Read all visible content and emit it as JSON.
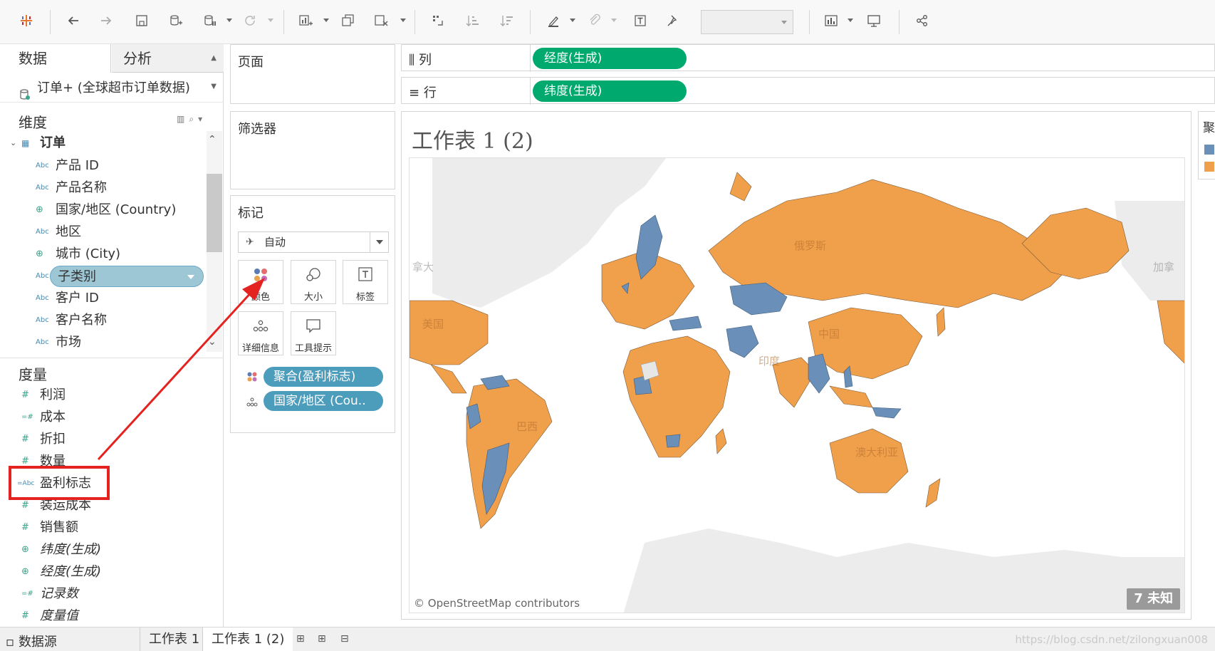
{
  "colors": {
    "accent_green": "#00a96e",
    "pill_blue": "#4c9cbb",
    "map_orange": "#f0a04b",
    "map_blue": "#6a8fb8",
    "highlight_red": "#e42321"
  },
  "toolbar": {
    "icons": [
      "tableau-logo-icon",
      "undo-icon",
      "redo-icon",
      "save-icon",
      "new-datasource-icon",
      "pause-updates-icon",
      "refresh-icon",
      "new-worksheet-icon",
      "duplicate-sheet-icon",
      "clear-sheet-icon",
      "swap-axes-icon",
      "sort-ascending-icon",
      "sort-descending-icon",
      "highlight-icon",
      "group-icon",
      "label-icon",
      "pin-icon",
      "show-me-icon",
      "presentation-icon",
      "share-icon"
    ]
  },
  "left_panel": {
    "tabs": {
      "data": "数据",
      "analysis": "分析"
    },
    "datasource": "订单+ (全球超市订单数据)",
    "dimensions": {
      "title": "维度",
      "folder": "订单",
      "fields": [
        {
          "label": "产品 ID",
          "type": "Abc"
        },
        {
          "label": "产品名称",
          "type": "Abc"
        },
        {
          "label": "国家/地区 (Country)",
          "type": "geo"
        },
        {
          "label": "地区",
          "type": "Abc"
        },
        {
          "label": "城市 (City)",
          "type": "geo"
        },
        {
          "label": "子类别",
          "type": "Abc"
        },
        {
          "label": "客户 ID",
          "type": "Abc"
        },
        {
          "label": "客户名称",
          "type": "Abc"
        },
        {
          "label": "市场",
          "type": "Abc"
        }
      ]
    },
    "measures": {
      "title": "度量",
      "fields": [
        {
          "label": "利润",
          "type": "#"
        },
        {
          "label": "成本",
          "type": "=#"
        },
        {
          "label": "折扣",
          "type": "#"
        },
        {
          "label": "数量",
          "type": "#"
        },
        {
          "label": "盈利标志",
          "type": "=Abc"
        },
        {
          "label": "装运成本",
          "type": "#"
        },
        {
          "label": "销售额",
          "type": "#"
        },
        {
          "label": "纬度(生成)",
          "type": "geo"
        },
        {
          "label": "经度(生成)",
          "type": "geo"
        },
        {
          "label": "记录数",
          "type": "=#"
        },
        {
          "label": "度量值",
          "type": "#"
        }
      ]
    },
    "abc": "Abc",
    "abc_calc": "=Abc"
  },
  "cards": {
    "pages": "页面",
    "filters": "筛选器",
    "marks": {
      "title": "标记",
      "type": "自动",
      "buttons": {
        "color": "颜色",
        "size": "大小",
        "label": "标签",
        "detail": "详细信息",
        "tooltip": "工具提示"
      },
      "pills": {
        "color": "聚合(盈利标志)",
        "detail": "国家/地区 (Cou.."
      }
    }
  },
  "shelves": {
    "columns": {
      "label": "列",
      "pill": "经度(生成)"
    },
    "rows": {
      "label": "行",
      "pill": "纬度(生成)"
    }
  },
  "viz": {
    "title": "工作表 1 (2)",
    "attribution": "© OpenStreetMap contributors",
    "unknown": "7 未知",
    "map_labels": {
      "russia": "俄罗斯",
      "usa": "美国",
      "china": "中国",
      "india": "印度",
      "brazil": "巴西",
      "australia": "澳大利亚",
      "canada_left": "拿大",
      "canada_right": "加拿"
    }
  },
  "legend": {
    "title": "聚"
  },
  "bottom": {
    "datasource": "数据源",
    "sheets": [
      "工作表 1",
      "工作表 1 (2)"
    ],
    "watermark": "https://blog.csdn.net/zilongxuan008"
  }
}
